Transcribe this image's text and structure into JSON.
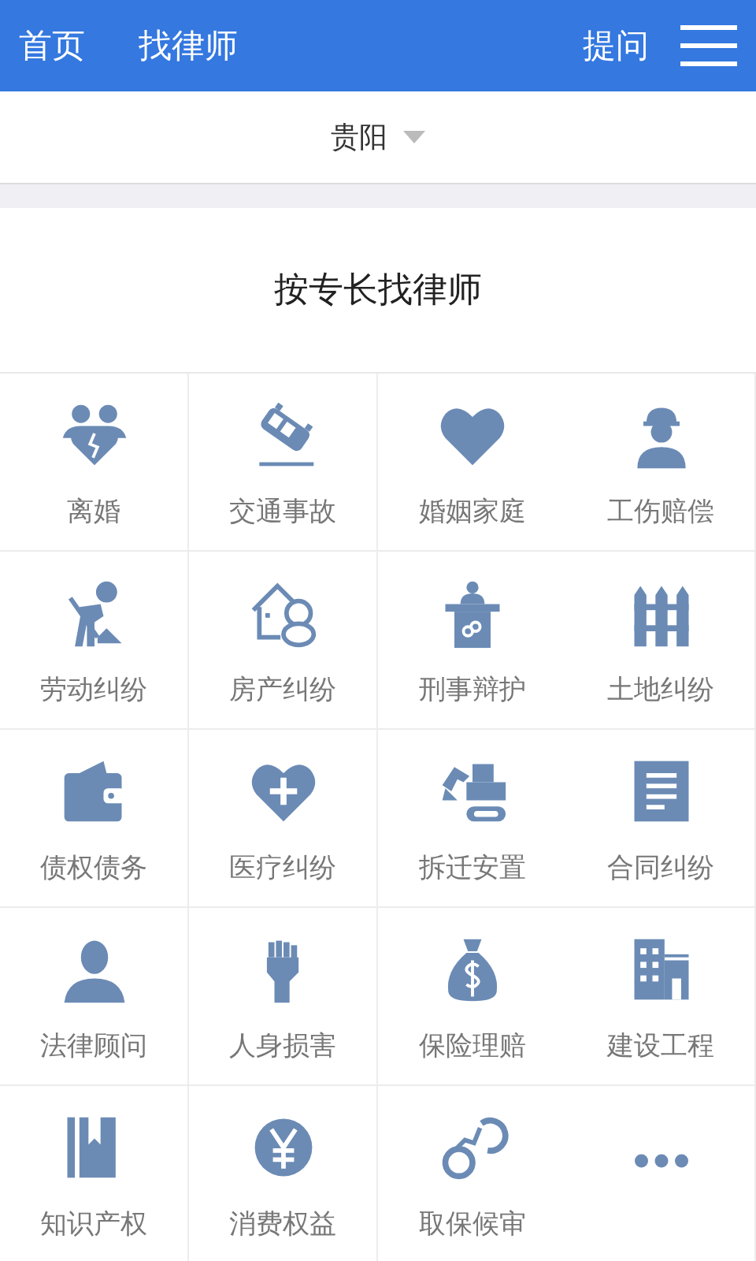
{
  "header": {
    "nav": [
      {
        "label": "首页"
      },
      {
        "label": "找律师"
      }
    ],
    "ask": "提问"
  },
  "city": {
    "name": "贵阳"
  },
  "section_title": "按专长找律师",
  "categories": [
    {
      "label": "离婚"
    },
    {
      "label": "交通事故"
    },
    {
      "label": "婚姻家庭"
    },
    {
      "label": "工伤赔偿"
    },
    {
      "label": "劳动纠纷"
    },
    {
      "label": "房产纠纷"
    },
    {
      "label": "刑事辩护"
    },
    {
      "label": "土地纠纷"
    },
    {
      "label": "债权债务"
    },
    {
      "label": "医疗纠纷"
    },
    {
      "label": "拆迁安置"
    },
    {
      "label": "合同纠纷"
    },
    {
      "label": "法律顾问"
    },
    {
      "label": "人身损害"
    },
    {
      "label": "保险理赔"
    },
    {
      "label": "建设工程"
    },
    {
      "label": "知识产权"
    },
    {
      "label": "消费权益"
    },
    {
      "label": "取保候审"
    }
  ]
}
